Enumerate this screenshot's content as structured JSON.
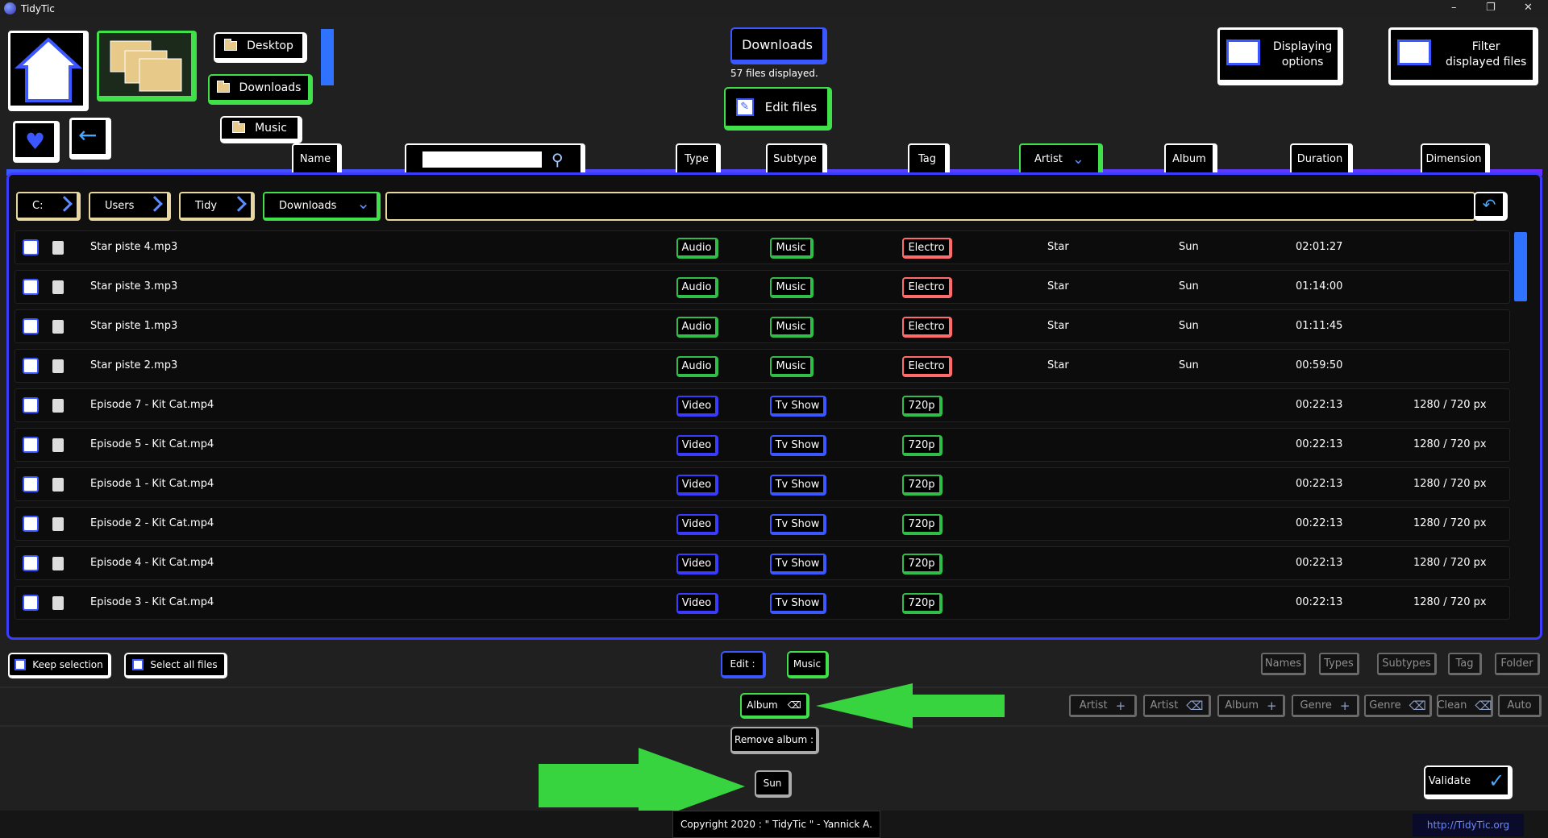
{
  "app": {
    "title": "TidyTic",
    "footer": "Copyright 2020 : \" TidyTic \" - Yannick A.",
    "link": "http://TidyTic.org"
  },
  "nav": {
    "desktop": "Desktop",
    "downloads": "Downloads",
    "music": "Music"
  },
  "header": {
    "folder": "Downloads",
    "count": "57 files displayed.",
    "edit": "Edit files",
    "display_options": [
      "Displaying",
      "options"
    ],
    "filter": [
      "Filter",
      "displayed files"
    ]
  },
  "columns": {
    "name": "Name",
    "search_placeholder": "",
    "type": "Type",
    "subtype": "Subtype",
    "tag": "Tag",
    "artist": "Artist",
    "album": "Album",
    "duration": "Duration",
    "dimension": "Dimension"
  },
  "breadcrumb": [
    "C:",
    "Users",
    "Tidy",
    "Downloads"
  ],
  "rows": [
    {
      "name": "Star piste 4.mp3",
      "type": "Audio",
      "subtype": "Music",
      "tag": "Electro",
      "artist": "Star",
      "album": "Sun",
      "duration": "02:01:27",
      "dimension": ""
    },
    {
      "name": "Star piste 3.mp3",
      "type": "Audio",
      "subtype": "Music",
      "tag": "Electro",
      "artist": "Star",
      "album": "Sun",
      "duration": "01:14:00",
      "dimension": ""
    },
    {
      "name": "Star piste 1.mp3",
      "type": "Audio",
      "subtype": "Music",
      "tag": "Electro",
      "artist": "Star",
      "album": "Sun",
      "duration": "01:11:45",
      "dimension": ""
    },
    {
      "name": "Star piste 2.mp3",
      "type": "Audio",
      "subtype": "Music",
      "tag": "Electro",
      "artist": "Star",
      "album": "Sun",
      "duration": "00:59:50",
      "dimension": ""
    },
    {
      "name": "Episode 7 - Kit Cat.mp4",
      "type": "Video",
      "subtype": "Tv Show",
      "tag": "720p",
      "artist": "",
      "album": "",
      "duration": "00:22:13",
      "dimension": "1280 / 720 px"
    },
    {
      "name": "Episode 5 - Kit Cat.mp4",
      "type": "Video",
      "subtype": "Tv Show",
      "tag": "720p",
      "artist": "",
      "album": "",
      "duration": "00:22:13",
      "dimension": "1280 / 720 px"
    },
    {
      "name": "Episode 1 - Kit Cat.mp4",
      "type": "Video",
      "subtype": "Tv Show",
      "tag": "720p",
      "artist": "",
      "album": "",
      "duration": "00:22:13",
      "dimension": "1280 / 720 px"
    },
    {
      "name": "Episode 2 - Kit Cat.mp4",
      "type": "Video",
      "subtype": "Tv Show",
      "tag": "720p",
      "artist": "",
      "album": "",
      "duration": "00:22:13",
      "dimension": "1280 / 720 px"
    },
    {
      "name": "Episode 4 - Kit Cat.mp4",
      "type": "Video",
      "subtype": "Tv Show",
      "tag": "720p",
      "artist": "",
      "album": "",
      "duration": "00:22:13",
      "dimension": "1280 / 720 px"
    },
    {
      "name": "Episode 3 - Kit Cat.mp4",
      "type": "Video",
      "subtype": "Tv Show",
      "tag": "720p",
      "artist": "",
      "album": "",
      "duration": "00:22:13",
      "dimension": "1280 / 720 px"
    }
  ],
  "footer_bar": {
    "keep": "Keep selection",
    "select_all": "Select all files",
    "edit": "Edit :",
    "music": "Music",
    "album": "Album",
    "remove_album": "Remove album :",
    "sun": "Sun",
    "validate": "Validate",
    "filters": [
      "Names",
      "Types",
      "Subtypes",
      "Tag",
      "Folder"
    ],
    "actions": [
      "Artist",
      "Artist",
      "Album",
      "Genre",
      "Genre",
      "Clean",
      "Auto"
    ]
  }
}
